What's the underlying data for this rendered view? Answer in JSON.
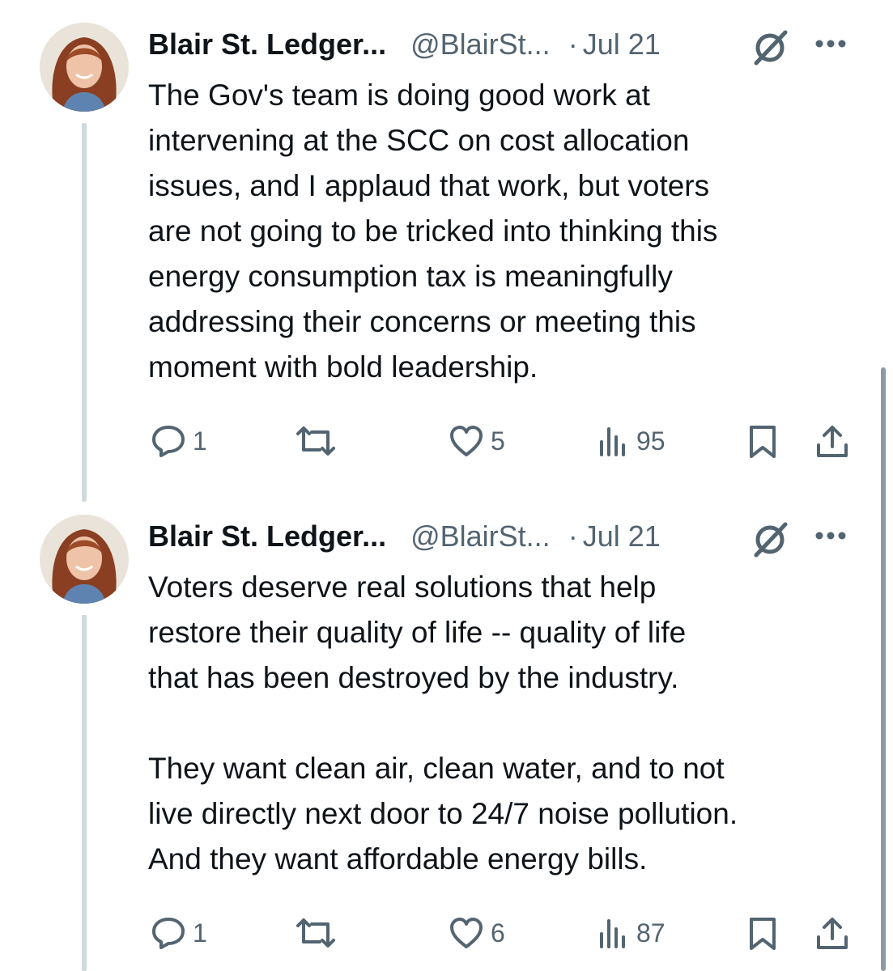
{
  "tweets": [
    {
      "author_name": "Blair St. Ledger...",
      "handle": "@BlairSt...",
      "separator": "·",
      "date": "Jul 21",
      "text": "The Gov's team is doing good work at\nintervening at the SCC on cost allocation\nissues, and I applaud that work, but voters\nare not going to be tricked into thinking this\nenergy consumption tax is meaningfully\naddressing their concerns or meeting this\nmoment with bold leadership.",
      "replies": "1",
      "likes": "5",
      "views": "95"
    },
    {
      "author_name": "Blair St. Ledger...",
      "handle": "@BlairSt...",
      "separator": "·",
      "date": "Jul 21",
      "text": "Voters deserve real solutions that help\nrestore their quality of life -- quality of life\nthat has been destroyed by the industry.\n\nThey want clean air, clean water, and to not\nlive directly next door to 24/7 noise pollution.\nAnd they want affordable energy bills.",
      "replies": "1",
      "likes": "6",
      "views": "87"
    }
  ],
  "icons": {
    "reply": "reply-icon",
    "retweet": "retweet-icon",
    "like": "heart-icon",
    "views": "views-icon",
    "bookmark": "bookmark-icon",
    "share": "share-icon",
    "grok": "grok-icon",
    "more": "more-icon"
  },
  "colors": {
    "text": "#0f1419",
    "secondary": "#536471",
    "thread_line": "#cfd9de"
  }
}
